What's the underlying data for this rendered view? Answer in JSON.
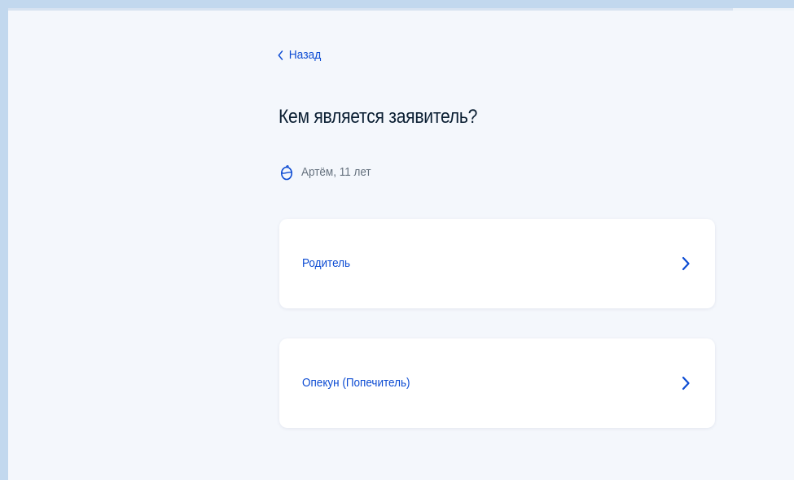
{
  "back": {
    "label": "Назад"
  },
  "heading": "Кем является заявитель?",
  "child": {
    "label": "Артём, 11 лет",
    "icon": "child-avatar-icon"
  },
  "options": [
    {
      "label": "Родитель",
      "icon": "chevron-right-icon"
    },
    {
      "label": "Опекун (Попечитель)",
      "icon": "chevron-right-icon"
    }
  ],
  "colors": {
    "accent": "#0d4cd3",
    "text": "#0b1f33",
    "muted": "#66727f",
    "page_bg": "#f4f7fc",
    "frame_bg": "#c2d8ee"
  }
}
